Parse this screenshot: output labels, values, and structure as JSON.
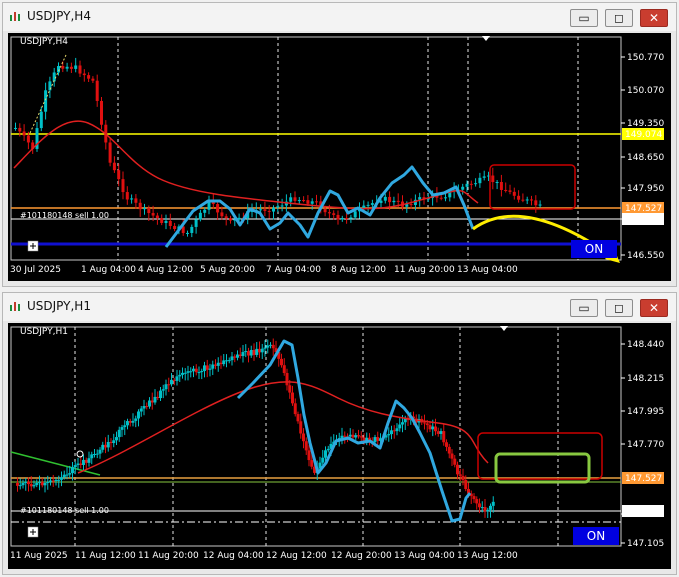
{
  "windows": [
    {
      "id": "h4",
      "title": "USDJPY,H4",
      "symbol_label": "USDJPY,H4",
      "order_label": "#101180148 sell 1.00",
      "on_label": "ON",
      "price_ticks": [
        "150.770",
        "150.070",
        "149.350",
        "148.650",
        "147.950",
        "147.296",
        "146.550"
      ],
      "date_ticks": [
        "30 Jul 2025",
        "1 Aug 04:00",
        "4 Aug 12:00",
        "5 Aug 20:00",
        "7 Aug 04:00",
        "8 Aug 12:00",
        "11 Aug 20:00",
        "13 Aug 04:00"
      ],
      "price_tags": [
        {
          "value": "149.074",
          "color": "#ffff00",
          "text_color": "#000000"
        },
        {
          "value": "147.527",
          "color": "#ff9933",
          "text_color": "#000000"
        },
        {
          "value": "147.296",
          "color": "#ffffff",
          "text_color": "#000000"
        }
      ],
      "colors": {
        "bull": "#00c0c8",
        "bear": "#e01010",
        "ma": "#e02020",
        "drawing": "#30a8e0",
        "arrow": "#ffee00",
        "box": "#cc0000",
        "support": "#1010d0"
      }
    },
    {
      "id": "h1",
      "title": "USDJPY,H1",
      "symbol_label": "USDJPY,H1",
      "order_label": "#101180148 sell 1.00",
      "on_label": "ON",
      "price_ticks": [
        "148.440",
        "148.215",
        "147.995",
        "147.770",
        "147.296",
        "147.105"
      ],
      "date_ticks": [
        "11 Aug 2025",
        "11 Aug 12:00",
        "11 Aug 20:00",
        "12 Aug 04:00",
        "12 Aug 12:00",
        "12 Aug 20:00",
        "13 Aug 04:00",
        "13 Aug 12:00"
      ],
      "price_tags": [
        {
          "value": "147.527",
          "color": "#ff9933",
          "text_color": "#000000"
        },
        {
          "value": "147.296",
          "color": "#ffffff",
          "text_color": "#000000"
        }
      ],
      "colors": {
        "bull": "#00c0c8",
        "bear": "#e01010",
        "ma": "#e02020",
        "drawing": "#30a8e0",
        "box": "#cc0000",
        "target": "#88c840",
        "trend": "#30c030"
      }
    }
  ],
  "window_buttons": {
    "minimize": "▭",
    "maximize": "◻",
    "close": "✕"
  }
}
